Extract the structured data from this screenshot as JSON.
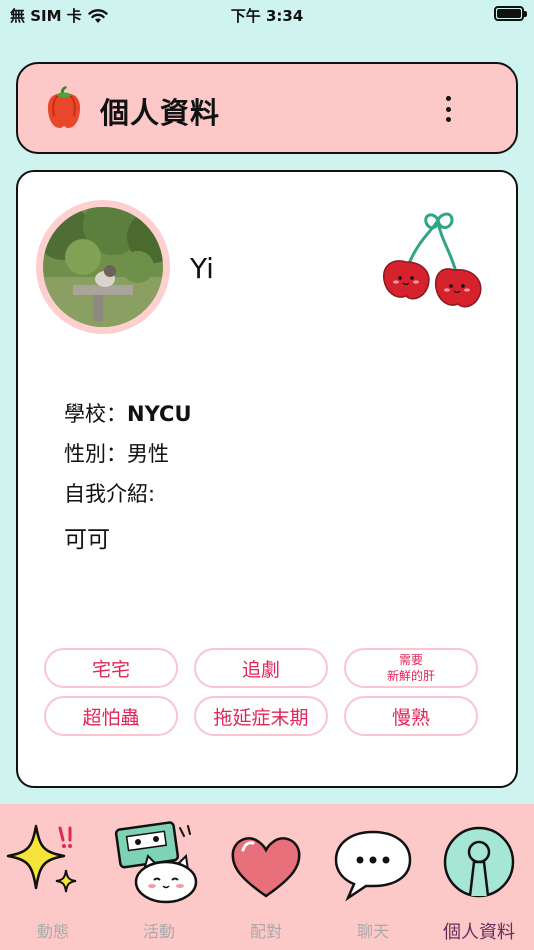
{
  "status_bar": {
    "carrier": "無 SIM 卡",
    "time": "下午 3:34"
  },
  "header": {
    "title": "個人資料"
  },
  "profile": {
    "name": "Yi",
    "school_label": "學校：",
    "school": "NYCU",
    "gender_label": "性別：",
    "gender": "男性",
    "intro_label": "自我介紹:",
    "intro": "可可",
    "tags": [
      {
        "label": "宅宅"
      },
      {
        "label": "追劇"
      },
      {
        "label": "需要",
        "label2": "新鮮的肝"
      },
      {
        "label": "超怕蟲"
      },
      {
        "label": "拖延症末期"
      },
      {
        "label": "慢熟"
      }
    ]
  },
  "tabs": [
    {
      "label": "動態",
      "icon": "sparkle-icon",
      "active": false
    },
    {
      "label": "活動",
      "icon": "cat-cassette-icon",
      "active": false
    },
    {
      "label": "配對",
      "icon": "heart-icon",
      "active": false
    },
    {
      "label": "聊天",
      "icon": "chat-bubble-icon",
      "active": false
    },
    {
      "label": "個人資料",
      "icon": "profile-keyhole-icon",
      "active": true
    }
  ],
  "colors": {
    "background": "#cff4ef",
    "header_bg": "#fdc9c8",
    "tag_text": "#e0265a",
    "tag_border": "#f7c6cf",
    "active_tab": "#6a2c5c"
  }
}
